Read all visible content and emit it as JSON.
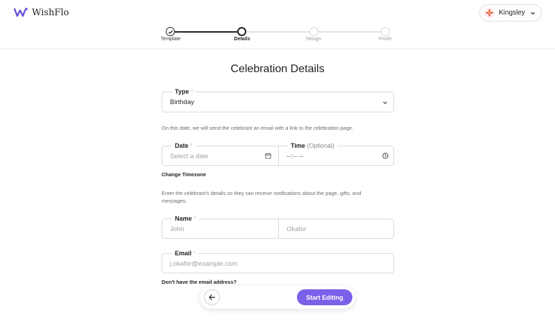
{
  "app": {
    "name": "WishFlo"
  },
  "user": {
    "name": "Kingsley"
  },
  "steps": [
    {
      "label": "Template",
      "state": "done"
    },
    {
      "label": "Details",
      "state": "current"
    },
    {
      "label": "Design",
      "state": "upcoming"
    },
    {
      "label": "Finish",
      "state": "upcoming"
    }
  ],
  "form": {
    "title": "Celebration Details",
    "type": {
      "label": "Type",
      "required_mark": "*",
      "value": "Birthday"
    },
    "date_hint": "On this date, we will send the celebrant an email with a link to the celebration page.",
    "date": {
      "label": "Date",
      "required_mark": "*",
      "placeholder": "Select a date"
    },
    "time": {
      "label": "Time",
      "optional": "(Optional)",
      "placeholder": "--:-- --"
    },
    "change_timezone": "Change Timezone",
    "details_hint": "Enter the celebrant's details so they can receive notifications about the page, gifts, and messages.",
    "name": {
      "label": "Name",
      "required_mark": "*",
      "first_placeholder": "John",
      "last_placeholder": "Okafor"
    },
    "email": {
      "label": "Email",
      "required_mark": "*",
      "placeholder": "j.okafor@example.com"
    },
    "no_email": "Don't have the email address?"
  },
  "actions": {
    "start": "Start Editing"
  },
  "colors": {
    "accent": "#7b61e8",
    "text": "#1f1f24",
    "muted": "#6b6b73",
    "border": "#d9d9de"
  }
}
